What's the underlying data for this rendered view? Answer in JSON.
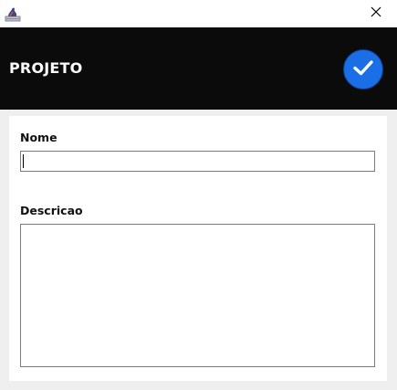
{
  "window": {
    "icon": "java-app-icon",
    "close_icon": "close-icon"
  },
  "header": {
    "title": "PROJETO",
    "confirm_icon": "checkmark-icon",
    "background": "#0b0b0b",
    "accent": "#1a6ee6"
  },
  "form": {
    "name_label": "Nome",
    "name_value": "",
    "description_label": "Descricao",
    "description_value": ""
  }
}
